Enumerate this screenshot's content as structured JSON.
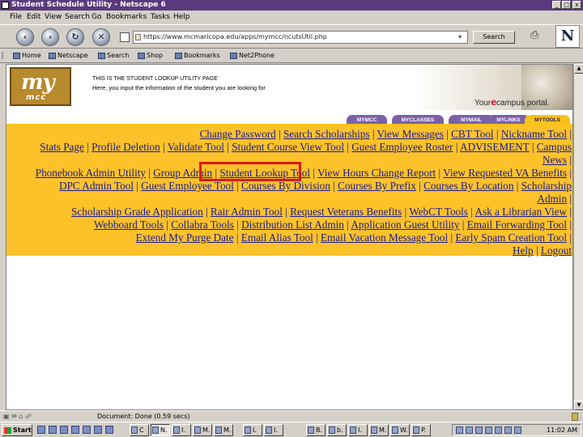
{
  "window": {
    "title": "Student Schedule Utility - Netscape 6",
    "controls": [
      "_",
      "□",
      "x"
    ]
  },
  "menu": [
    "File",
    "Edit",
    "View",
    "Search",
    "Go",
    "Bookmarks",
    "Tasks",
    "Help"
  ],
  "nav": {
    "url": "https://www.mcmaricopa.edu/apps/mymcc/ncutsUtil.php",
    "search_label": "Search"
  },
  "personal_toolbar": [
    "Home",
    "Netscape",
    "Search",
    "Shop",
    "Bookmarks",
    "Net2Phone"
  ],
  "banner": {
    "logo_my": "my",
    "logo_mcc": "mcc",
    "heading": "THIS IS THE STUDENT LOOKUP UTILITY PAGE",
    "subheading": "Here, you input the information of the student you are looking for",
    "portal_prefix": "Your",
    "portal_e": "e",
    "portal_suffix": "campus portal."
  },
  "tabs": [
    "MYMCC",
    "MYCLASSES",
    "MYMAIL",
    "MYLINKS",
    "MYTOOLS"
  ],
  "links": {
    "line1": [
      "Change Password",
      "Search Scholarships",
      "View Messages",
      "CBT Tool",
      "Nickname Tool"
    ],
    "line2": [
      "Stats Page",
      "Profile Deletion",
      "Validate Tool",
      "Student Course View Tool",
      "Guest Employee Roster",
      "ADVISEMENT",
      "Campus"
    ],
    "line3": [
      "News"
    ],
    "line4": [
      "Phonebook Admin Utility",
      "Group Admin",
      "Student Lookup Tool",
      "View Hours Change Report",
      "View Requested VA Benefits"
    ],
    "line5": [
      "DPC Admin Tool",
      "Guest Employee Tool",
      "Courses By Division",
      "Courses By Prefix",
      "Courses By Location",
      "Scholarship"
    ],
    "line6": [
      "Admin"
    ],
    "line7": [
      "Scholarship Grade Application",
      "Rair Admin Tool",
      "Request Veterans Benefits",
      "WebCT Tools",
      "Ask a Librarian View"
    ],
    "line8": [
      "Webboard Tools",
      "Collabra Tools",
      "Distribution List Admin",
      "Application Guest Utility",
      "Email Forwarding Tool"
    ],
    "line9": [
      "Extend My Purge Date",
      "Email Alias Tool",
      "Email Vacation Message Tool",
      "Early Spam Creation Tool"
    ],
    "line10": [
      "Help",
      "Logout"
    ]
  },
  "status": {
    "text": "Document: Done (0.59 secs)"
  },
  "taskbar": {
    "start": "Start",
    "tasks": [
      "C",
      "N.",
      "I.",
      "M.",
      "M.",
      "I.",
      "I.",
      "B.",
      "b.",
      "I.",
      "M.",
      "W.",
      "P."
    ],
    "clock": "11:02 AM"
  },
  "colors": {
    "title_bar": "#5a3a7c",
    "link_panel": "#fdc22a",
    "tab": "#7b61a6",
    "link": "#1a1a8a",
    "highlight_box": "#e01818"
  }
}
